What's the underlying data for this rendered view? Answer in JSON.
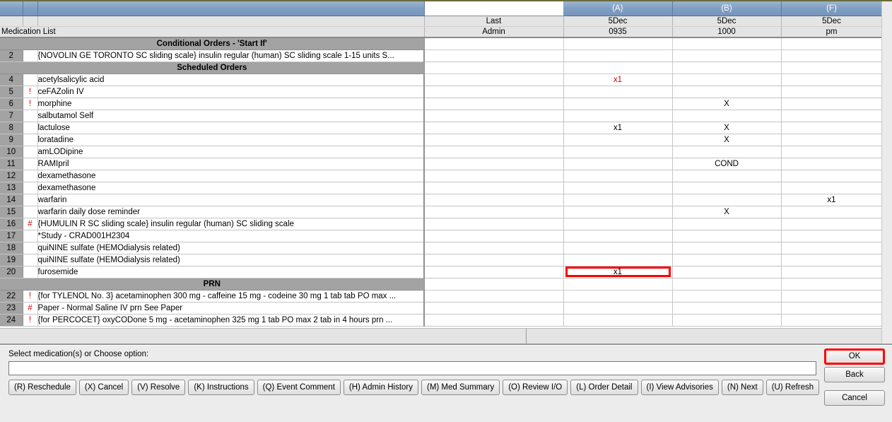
{
  "window": {
    "list_title": "Medication List"
  },
  "grid": {
    "columns": {
      "row_number": "",
      "flag": "",
      "medication": "",
      "last_admin": {
        "line1": "Last",
        "line2": "Admin"
      },
      "timeslots": [
        {
          "code": "(A)",
          "date": "5Dec",
          "time": "0935"
        },
        {
          "code": "(B)",
          "date": "5Dec",
          "time": "1000"
        },
        {
          "code": "(F)",
          "date": "5Dec",
          "time": "pm"
        }
      ]
    },
    "sections": [
      {
        "title": "Conditional Orders - 'Start If'",
        "rows": [
          {
            "num": "2",
            "flag": "",
            "name": "{NOVOLIN GE TORONTO SC sliding scale} insulin regular (human) SC sliding scale 1-15 units S...",
            "last": "",
            "a": "",
            "b": "",
            "f": "",
            "a_red": false,
            "highlight_a": false
          }
        ]
      },
      {
        "title": "Scheduled Orders",
        "rows": [
          {
            "num": "4",
            "flag": "",
            "name": "acetylsalicylic acid",
            "last": "",
            "a": "x1",
            "b": "",
            "f": "",
            "a_red": true,
            "highlight_a": false
          },
          {
            "num": "5",
            "flag": "!",
            "name": "ceFAZolin IV",
            "last": "",
            "a": "",
            "b": "",
            "f": "",
            "a_red": false,
            "highlight_a": false
          },
          {
            "num": "6",
            "flag": "!",
            "name": "morphine",
            "last": "",
            "a": "",
            "b": "X",
            "f": "",
            "a_red": false,
            "highlight_a": false
          },
          {
            "num": "7",
            "flag": "",
            "name": "salbutamol  Self",
            "last": "",
            "a": "",
            "b": "",
            "f": "",
            "a_red": false,
            "highlight_a": false
          },
          {
            "num": "8",
            "flag": "",
            "name": "lactulose",
            "last": "",
            "a": "x1",
            "b": "X",
            "f": "",
            "a_red": false,
            "highlight_a": false
          },
          {
            "num": "9",
            "flag": "",
            "name": "loratadine",
            "last": "",
            "a": "",
            "b": "X",
            "f": "",
            "a_red": false,
            "highlight_a": false
          },
          {
            "num": "10",
            "flag": "",
            "name": "amLODipine",
            "last": "",
            "a": "",
            "b": "",
            "f": "",
            "a_red": false,
            "highlight_a": false
          },
          {
            "num": "11",
            "flag": "",
            "name": "RAMIpril",
            "last": "",
            "a": "",
            "b": "COND",
            "f": "",
            "a_red": false,
            "highlight_a": false
          },
          {
            "num": "12",
            "flag": "",
            "name": "dexamethasone",
            "last": "",
            "a": "",
            "b": "",
            "f": "",
            "a_red": false,
            "highlight_a": false
          },
          {
            "num": "13",
            "flag": "",
            "name": "dexamethasone",
            "last": "",
            "a": "",
            "b": "",
            "f": "",
            "a_red": false,
            "highlight_a": false
          },
          {
            "num": "14",
            "flag": "",
            "name": "warfarin",
            "last": "",
            "a": "",
            "b": "",
            "f": "x1",
            "a_red": false,
            "highlight_a": false
          },
          {
            "num": "15",
            "flag": "",
            "name": "warfarin daily dose reminder",
            "last": "",
            "a": "",
            "b": "X",
            "f": "",
            "a_red": false,
            "highlight_a": false
          },
          {
            "num": "16",
            "flag": "#",
            "name": "{HUMULIN R SC sliding scale} insulin regular (human) SC sliding scale",
            "last": "",
            "a": "",
            "b": "",
            "f": "",
            "a_red": false,
            "highlight_a": false
          },
          {
            "num": "17",
            "flag": "",
            "name": "*Study - CRAD001H2304",
            "last": "",
            "a": "",
            "b": "",
            "f": "",
            "a_red": false,
            "highlight_a": false
          },
          {
            "num": "18",
            "flag": "",
            "name": "quiNINE sulfate (HEMOdialysis related)",
            "last": "",
            "a": "",
            "b": "",
            "f": "",
            "a_red": false,
            "highlight_a": false
          },
          {
            "num": "19",
            "flag": "",
            "name": "quiNINE sulfate (HEMOdialysis related)",
            "last": "",
            "a": "",
            "b": "",
            "f": "",
            "a_red": false,
            "highlight_a": false
          },
          {
            "num": "20",
            "flag": "",
            "name": "furosemide",
            "last": "",
            "a": "x1",
            "b": "",
            "f": "",
            "a_red": false,
            "highlight_a": true
          }
        ]
      },
      {
        "title": "PRN",
        "rows": [
          {
            "num": "22",
            "flag": "!",
            "name": "{for TYLENOL No. 3} acetaminophen 300 mg - caffeine 15 mg - codeine 30 mg 1 tab tab PO max ...",
            "last": "",
            "a": "",
            "b": "",
            "f": "",
            "a_red": false,
            "highlight_a": false
          },
          {
            "num": "23",
            "flag": "#",
            "name": "Paper - Normal Saline IV prn See Paper",
            "last": "",
            "a": "",
            "b": "",
            "f": "",
            "a_red": false,
            "highlight_a": false
          },
          {
            "num": "24",
            "flag": "!",
            "name": "{for PERCOCET} oxyCODone 5 mg - acetaminophen 325 mg  1 tab PO max 2 tab in 4 hours prn ...",
            "last": "",
            "a": "",
            "b": "",
            "f": "",
            "a_red": false,
            "highlight_a": false
          }
        ]
      }
    ]
  },
  "footer": {
    "prompt": "Select medication(s) or Choose option:",
    "input_value": "",
    "input_placeholder": "",
    "action_buttons": [
      "(R) Reschedule",
      "(X) Cancel",
      "(V) Resolve",
      "(K) Instructions",
      "(Q) Event Comment",
      "(H) Admin History",
      "(M) Med Summary",
      "(O) Review I/O",
      "(L) Order Detail",
      "(I) View Advisories",
      "(N) Next",
      "(U) Refresh"
    ],
    "ok_label": "OK",
    "back_label": "Back",
    "cancel_label": "Cancel"
  },
  "colors": {
    "header_blue": "#7e9dc1",
    "section_grey": "#a3a3a3",
    "alert_red": "#d40000",
    "highlight_red": "#ff0000"
  }
}
